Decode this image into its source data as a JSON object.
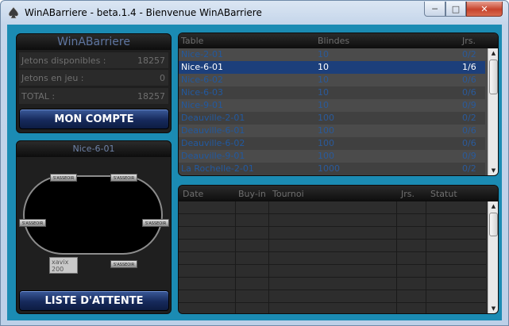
{
  "window": {
    "title": "WinABarriere - beta.1.4 - Bienvenue WinABarriere",
    "icon": "spade-app-icon"
  },
  "account": {
    "header": "WinABarriere",
    "rows": [
      {
        "label": "Jetons disponibles :",
        "value": "18257"
      },
      {
        "label": "Jetons en jeu :",
        "value": "0"
      },
      {
        "label": "TOTAL :",
        "value": "18257"
      }
    ],
    "button": "MON COMPTE"
  },
  "table_preview": {
    "header": "Nice-6-01",
    "seat_label": "S'ASSEOIR",
    "player": {
      "name": "xavix",
      "stack": "200"
    },
    "button": "LISTE D'ATTENTE"
  },
  "tables": {
    "columns": [
      "Table",
      "Blindes",
      "Jrs."
    ],
    "rows": [
      {
        "table": "Nice-2-01",
        "blinds": "10",
        "players": "0/2"
      },
      {
        "table": "Nice-6-01",
        "blinds": "10",
        "players": "1/6"
      },
      {
        "table": "Nice-6-02",
        "blinds": "10",
        "players": "0/6"
      },
      {
        "table": "Nice-6-03",
        "blinds": "10",
        "players": "0/6"
      },
      {
        "table": "Nice-9-01",
        "blinds": "10",
        "players": "0/9"
      },
      {
        "table": "Deauville-2-01",
        "blinds": "100",
        "players": "0/2"
      },
      {
        "table": "Deauville-6-01",
        "blinds": "100",
        "players": "0/6"
      },
      {
        "table": "Deauville-6-02",
        "blinds": "100",
        "players": "0/6"
      },
      {
        "table": "Deauville-9-01",
        "blinds": "100",
        "players": "0/9"
      },
      {
        "table": "La Rochelle-2-01",
        "blinds": "1000",
        "players": "0/2"
      }
    ],
    "selected_index": 1
  },
  "tournaments": {
    "columns": [
      "Date",
      "Buy-in",
      "Tournoi",
      "Jrs.",
      "Statut"
    ]
  }
}
